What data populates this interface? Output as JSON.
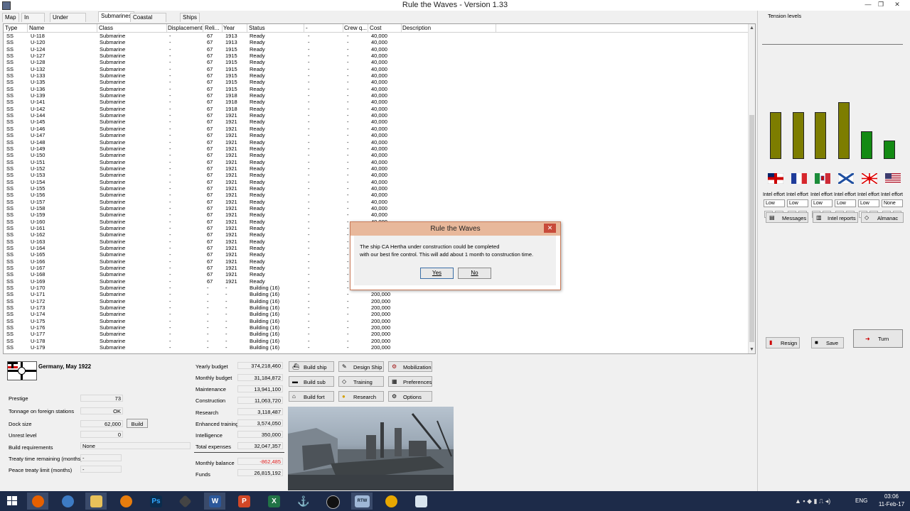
{
  "window": {
    "title": "Rule the Waves - Version 1.33",
    "min": "—",
    "restore": "❐",
    "close": "✕"
  },
  "tabs": [
    "Map",
    "In service",
    "Under construction",
    "Submarines",
    "Coastal fortifications",
    "Ships sunk"
  ],
  "active_tab": "Submarines",
  "columns": [
    "Type",
    "Name",
    "Class",
    "Displacement",
    "Reli...",
    "Year",
    "Status",
    "-",
    "Crew q...",
    "Cost",
    "Description"
  ],
  "rows": [
    [
      "SS",
      "U-118",
      "Submarine",
      "-",
      "67",
      "1913",
      "Ready",
      "-",
      "-",
      "40,000",
      ""
    ],
    [
      "SS",
      "U-120",
      "Submarine",
      "-",
      "67",
      "1913",
      "Ready",
      "-",
      "-",
      "40,000",
      ""
    ],
    [
      "SS",
      "U-124",
      "Submarine",
      "-",
      "67",
      "1915",
      "Ready",
      "-",
      "-",
      "40,000",
      ""
    ],
    [
      "SS",
      "U-127",
      "Submarine",
      "-",
      "67",
      "1915",
      "Ready",
      "-",
      "-",
      "40,000",
      ""
    ],
    [
      "SS",
      "U-128",
      "Submarine",
      "-",
      "67",
      "1915",
      "Ready",
      "-",
      "-",
      "40,000",
      ""
    ],
    [
      "SS",
      "U-132",
      "Submarine",
      "-",
      "67",
      "1915",
      "Ready",
      "-",
      "-",
      "40,000",
      ""
    ],
    [
      "SS",
      "U-133",
      "Submarine",
      "-",
      "67",
      "1915",
      "Ready",
      "-",
      "-",
      "40,000",
      ""
    ],
    [
      "SS",
      "U-135",
      "Submarine",
      "-",
      "67",
      "1915",
      "Ready",
      "-",
      "-",
      "40,000",
      ""
    ],
    [
      "SS",
      "U-136",
      "Submarine",
      "-",
      "67",
      "1915",
      "Ready",
      "-",
      "-",
      "40,000",
      ""
    ],
    [
      "SS",
      "U-139",
      "Submarine",
      "-",
      "67",
      "1918",
      "Ready",
      "-",
      "-",
      "40,000",
      ""
    ],
    [
      "SS",
      "U-141",
      "Submarine",
      "-",
      "67",
      "1918",
      "Ready",
      "-",
      "-",
      "40,000",
      ""
    ],
    [
      "SS",
      "U-142",
      "Submarine",
      "-",
      "67",
      "1918",
      "Ready",
      "-",
      "-",
      "40,000",
      ""
    ],
    [
      "SS",
      "U-144",
      "Submarine",
      "-",
      "67",
      "1921",
      "Ready",
      "-",
      "-",
      "40,000",
      ""
    ],
    [
      "SS",
      "U-145",
      "Submarine",
      "-",
      "67",
      "1921",
      "Ready",
      "-",
      "-",
      "40,000",
      ""
    ],
    [
      "SS",
      "U-146",
      "Submarine",
      "-",
      "67",
      "1921",
      "Ready",
      "-",
      "-",
      "40,000",
      ""
    ],
    [
      "SS",
      "U-147",
      "Submarine",
      "-",
      "67",
      "1921",
      "Ready",
      "-",
      "-",
      "40,000",
      ""
    ],
    [
      "SS",
      "U-148",
      "Submarine",
      "-",
      "67",
      "1921",
      "Ready",
      "-",
      "-",
      "40,000",
      ""
    ],
    [
      "SS",
      "U-149",
      "Submarine",
      "-",
      "67",
      "1921",
      "Ready",
      "-",
      "-",
      "40,000",
      ""
    ],
    [
      "SS",
      "U-150",
      "Submarine",
      "-",
      "67",
      "1921",
      "Ready",
      "-",
      "-",
      "40,000",
      ""
    ],
    [
      "SS",
      "U-151",
      "Submarine",
      "-",
      "67",
      "1921",
      "Ready",
      "-",
      "-",
      "40,000",
      ""
    ],
    [
      "SS",
      "U-152",
      "Submarine",
      "-",
      "67",
      "1921",
      "Ready",
      "-",
      "-",
      "40,000",
      ""
    ],
    [
      "SS",
      "U-153",
      "Submarine",
      "-",
      "67",
      "1921",
      "Ready",
      "-",
      "-",
      "40,000",
      ""
    ],
    [
      "SS",
      "U-154",
      "Submarine",
      "-",
      "67",
      "1921",
      "Ready",
      "-",
      "-",
      "40,000",
      ""
    ],
    [
      "SS",
      "U-155",
      "Submarine",
      "-",
      "67",
      "1921",
      "Ready",
      "-",
      "-",
      "40,000",
      ""
    ],
    [
      "SS",
      "U-156",
      "Submarine",
      "-",
      "67",
      "1921",
      "Ready",
      "-",
      "-",
      "40,000",
      ""
    ],
    [
      "SS",
      "U-157",
      "Submarine",
      "-",
      "67",
      "1921",
      "Ready",
      "-",
      "-",
      "40,000",
      ""
    ],
    [
      "SS",
      "U-158",
      "Submarine",
      "-",
      "67",
      "1921",
      "Ready",
      "-",
      "-",
      "40,000",
      ""
    ],
    [
      "SS",
      "U-159",
      "Submarine",
      "-",
      "67",
      "1921",
      "Ready",
      "-",
      "-",
      "40,000",
      ""
    ],
    [
      "SS",
      "U-160",
      "Submarine",
      "-",
      "67",
      "1921",
      "Ready",
      "-",
      "-",
      "40,000",
      ""
    ],
    [
      "SS",
      "U-161",
      "Submarine",
      "-",
      "67",
      "1921",
      "Ready",
      "-",
      "-",
      "",
      ""
    ],
    [
      "SS",
      "U-162",
      "Submarine",
      "-",
      "67",
      "1921",
      "Ready",
      "-",
      "-",
      "",
      ""
    ],
    [
      "SS",
      "U-163",
      "Submarine",
      "-",
      "67",
      "1921",
      "Ready",
      "-",
      "-",
      "",
      ""
    ],
    [
      "SS",
      "U-164",
      "Submarine",
      "-",
      "67",
      "1921",
      "Ready",
      "-",
      "-",
      "",
      ""
    ],
    [
      "SS",
      "U-165",
      "Submarine",
      "-",
      "67",
      "1921",
      "Ready",
      "-",
      "-",
      "",
      ""
    ],
    [
      "SS",
      "U-166",
      "Submarine",
      "-",
      "67",
      "1921",
      "Ready",
      "-",
      "-",
      "",
      ""
    ],
    [
      "SS",
      "U-167",
      "Submarine",
      "-",
      "67",
      "1921",
      "Ready",
      "-",
      "-",
      "",
      ""
    ],
    [
      "SS",
      "U-168",
      "Submarine",
      "-",
      "67",
      "1921",
      "Ready",
      "-",
      "-",
      "",
      ""
    ],
    [
      "SS",
      "U-169",
      "Submarine",
      "-",
      "67",
      "1921",
      "Ready",
      "-",
      "-",
      "",
      ""
    ],
    [
      "SS",
      "U-170",
      "Submarine",
      "-",
      "-",
      "-",
      "Building (16)",
      "-",
      "-",
      "",
      ""
    ],
    [
      "SS",
      "U-171",
      "Submarine",
      "-",
      "-",
      "-",
      "Building (16)",
      "-",
      "-",
      "200,000",
      ""
    ],
    [
      "SS",
      "U-172",
      "Submarine",
      "-",
      "-",
      "-",
      "Building (16)",
      "-",
      "-",
      "200,000",
      ""
    ],
    [
      "SS",
      "U-173",
      "Submarine",
      "-",
      "-",
      "-",
      "Building (16)",
      "-",
      "-",
      "200,000",
      ""
    ],
    [
      "SS",
      "U-174",
      "Submarine",
      "-",
      "-",
      "-",
      "Building (16)",
      "-",
      "-",
      "200,000",
      ""
    ],
    [
      "SS",
      "U-175",
      "Submarine",
      "-",
      "-",
      "-",
      "Building (16)",
      "-",
      "-",
      "200,000",
      ""
    ],
    [
      "SS",
      "U-176",
      "Submarine",
      "-",
      "-",
      "-",
      "Building (16)",
      "-",
      "-",
      "200,000",
      ""
    ],
    [
      "SS",
      "U-177",
      "Submarine",
      "-",
      "-",
      "-",
      "Building (16)",
      "-",
      "-",
      "200,000",
      ""
    ],
    [
      "SS",
      "U-178",
      "Submarine",
      "-",
      "-",
      "-",
      "Building (16)",
      "-",
      "-",
      "200,000",
      ""
    ],
    [
      "SS",
      "U-179",
      "Submarine",
      "-",
      "-",
      "-",
      "Building (16)",
      "-",
      "-",
      "200,000",
      ""
    ]
  ],
  "dialog": {
    "title": "Rule the Waves",
    "close": "✕",
    "line1": "The ship CA Hertha under construction could be completed",
    "line2": "with our best fire control. This will add about 1 month to construction time.",
    "yes": "Yes",
    "no": "No"
  },
  "nation": "Germany, May 1922",
  "stats": {
    "prestige_label": "Prestige",
    "prestige": "73",
    "tonnage_label": "Tonnage on foreign stations",
    "tonnage": "OK",
    "dock_label": "Dock size",
    "dock": "62,000",
    "build": "Build",
    "unrest_label": "Unrest level",
    "unrest": "0",
    "build_req_label": "Build requirements",
    "build_req": "None",
    "treaty_label": "Treaty time remaining (months)",
    "treaty": "-",
    "peace_label": "Peace treaty limit (months)",
    "peace": "-"
  },
  "budget": {
    "yearly_label": "Yearly budget",
    "yearly": "374,218,460",
    "monthly_label": "Monthly budget",
    "monthly": "31,184,872",
    "maintenance_label": "Maintenance",
    "maintenance": "13,941,100",
    "construction_label": "Construction",
    "construction": "11,063,720",
    "research_label": "Research",
    "research": "3,118,487",
    "training_label": "Enhanced training",
    "training": "3,574,050",
    "intelligence_label": "Intelligence",
    "intelligence": "350,000",
    "total_label": "Total expenses",
    "total": "32,047,357",
    "balance_label": "Monthly balance",
    "balance": "-862,485",
    "funds_label": "Funds",
    "funds": "26,815,192"
  },
  "buttons": {
    "build_ship": "Build ship",
    "design_ship": "Design Ship",
    "mobilization": "Mobilization",
    "build_sub": "Build sub",
    "training": "Training",
    "preferences": "Preferences",
    "build_fort": "Build fort",
    "research": "Research",
    "options": "Options"
  },
  "right": {
    "tension_label": "Tension levels",
    "tension": [
      {
        "nation": "Britain",
        "level": 0.61,
        "color": "#7d7d00"
      },
      {
        "nation": "France",
        "level": 0.61,
        "color": "#7d7d00"
      },
      {
        "nation": "Italy",
        "level": 0.61,
        "color": "#7d7d00"
      },
      {
        "nation": "Russia",
        "level": 0.73,
        "color": "#7d7d00"
      },
      {
        "nation": "Japan",
        "level": 0.36,
        "color": "#138a13"
      },
      {
        "nation": "USA",
        "level": 0.24,
        "color": "#138a13"
      }
    ],
    "intel_label": "Intel effort",
    "intel": [
      "Low",
      "Low",
      "Low",
      "Low",
      "Low",
      "None"
    ],
    "plus": "+",
    "minus": "-",
    "messages": "Messages",
    "intel_reports": "Intel reports",
    "almanac": "Almanac",
    "resign": "Resign",
    "save": "Save",
    "turn": "Turn"
  },
  "taskbar": {
    "lang": "ENG",
    "time": "03:06",
    "date": "11-Feb-17",
    "rtw": "RTW"
  }
}
